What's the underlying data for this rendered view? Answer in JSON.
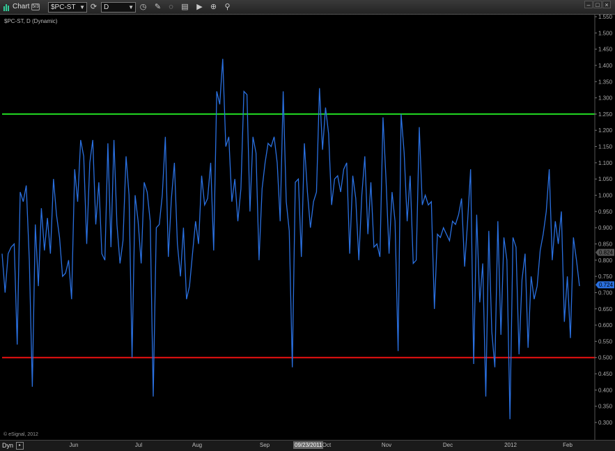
{
  "titlebar": {
    "title": "Chart",
    "badge": "5/3",
    "symbol": "$PC-ST",
    "interval": "D",
    "tools": [
      "refresh-icon",
      "crosshair-icon",
      "pencil-icon",
      "zoom-icon",
      "layout-icon",
      "play-icon",
      "magnify-icon",
      "pin-icon"
    ],
    "window_controls": [
      "minimize-icon",
      "maximize-icon",
      "close-icon"
    ]
  },
  "chart": {
    "legend": "$PC-ST, D (Dynamic)",
    "copyright": "© eSignal, 2012",
    "y_ticks": [
      "1.550",
      "1.500",
      "1.450",
      "1.400",
      "1.350",
      "1.300",
      "1.250",
      "1.200",
      "1.150",
      "1.100",
      "1.050",
      "1.000",
      "0.950",
      "0.900",
      "0.850",
      "0.800",
      "0.750",
      "0.700",
      "0.650",
      "0.600",
      "0.550",
      "0.500",
      "0.450",
      "0.400",
      "0.350",
      "0.300"
    ],
    "last_value_label": "0.724",
    "secondary_value_label": "0.824",
    "colors": {
      "series": "#2a70e0",
      "upper_line": "#22dd22",
      "lower_line": "#ee1111",
      "badge": "#2a70e0",
      "badge2": "#555555"
    }
  },
  "chart_data": {
    "type": "line",
    "title": "$PC-ST, D (Dynamic)",
    "ylim": [
      0.3,
      1.55
    ],
    "reference_lines": [
      1.25,
      0.5
    ],
    "x_labels": [
      "Jun",
      "Jul",
      "Aug",
      "Sep",
      "Oct",
      "Nov",
      "Dec",
      "2012",
      "Feb"
    ],
    "highlighted_date": "09/23/2011",
    "series": [
      {
        "values": [
          0.82,
          0.7,
          0.82,
          0.84,
          0.85,
          0.54,
          1.01,
          0.98,
          1.03,
          0.8,
          0.41,
          0.91,
          0.72,
          0.96,
          0.83,
          0.93,
          0.82,
          1.05,
          0.94,
          0.87,
          0.75,
          0.76,
          0.8,
          0.68,
          1.08,
          0.98,
          1.17,
          1.12,
          0.85,
          1.1,
          1.17,
          0.91,
          1.04,
          0.82,
          0.8,
          1.16,
          0.84,
          1.17,
          0.91,
          0.79,
          0.86,
          1.12,
          1.0,
          0.5,
          1.0,
          0.92,
          0.79,
          1.04,
          1.01,
          0.92,
          0.38,
          0.9,
          0.91,
          1.0,
          1.18,
          0.81,
          0.99,
          1.1,
          0.85,
          0.75,
          0.9,
          0.68,
          0.72,
          0.82,
          0.92,
          0.85,
          1.06,
          0.97,
          0.99,
          1.1,
          0.83,
          1.32,
          1.28,
          1.42,
          1.15,
          1.18,
          0.98,
          1.05,
          0.92,
          1.02,
          1.32,
          1.31,
          0.95,
          1.18,
          1.13,
          0.8,
          1.02,
          1.1,
          1.16,
          1.15,
          1.18,
          1.1,
          0.92,
          1.32,
          0.98,
          0.89,
          0.47,
          1.04,
          1.05,
          0.81,
          1.16,
          1.01,
          0.9,
          0.98,
          1.01,
          1.33,
          1.14,
          1.27,
          1.19,
          0.97,
          1.05,
          1.06,
          1.01,
          1.08,
          1.1,
          0.82,
          1.06,
          0.99,
          0.8,
          1.0,
          1.12,
          0.88,
          1.04,
          0.84,
          0.85,
          0.81,
          1.24,
          1.05,
          0.82,
          1.01,
          0.92,
          0.52,
          1.25,
          1.13,
          0.92,
          1.06,
          0.79,
          0.8,
          1.21,
          0.97,
          1.0,
          0.97,
          0.98,
          0.65,
          0.88,
          0.87,
          0.9,
          0.88,
          0.86,
          0.92,
          0.91,
          0.94,
          0.99,
          0.78,
          0.92,
          1.08,
          0.48,
          0.94,
          0.67,
          0.79,
          0.38,
          0.89,
          0.58,
          0.47,
          0.92,
          0.57,
          0.87,
          0.8,
          0.31,
          0.87,
          0.84,
          0.51,
          0.74,
          0.82,
          0.53,
          0.75,
          0.68,
          0.72,
          0.83,
          0.88,
          0.95,
          1.08,
          0.8,
          0.92,
          0.85,
          0.95,
          0.61,
          0.75,
          0.56,
          0.87,
          0.8,
          0.72
        ]
      }
    ]
  },
  "bottombar": {
    "dyn": "Dyn",
    "months": [
      "Jun",
      "Jul",
      "Aug",
      "Sep",
      "Oct",
      "Nov",
      "Dec",
      "2012",
      "Feb"
    ],
    "date_flag": "09/23/2011"
  }
}
